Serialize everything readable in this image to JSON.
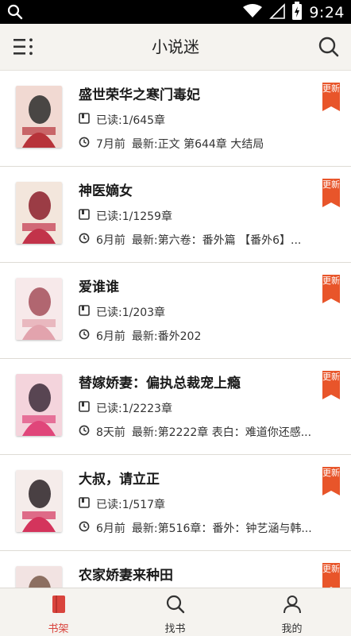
{
  "status_bar": {
    "time": "9:24"
  },
  "app_bar": {
    "title": "小说迷"
  },
  "books": [
    {
      "title": "盛世荣华之寒门毒妃",
      "read": "已读:1/645章",
      "ago": "7月前",
      "latest": "最新:正文 第644章 大结局",
      "badge": "更新",
      "cover_colors": [
        "#f1d9d2",
        "#b7333a",
        "#2b2b2b"
      ]
    },
    {
      "title": "神医嫡女",
      "read": "已读:1/1259章",
      "ago": "6月前",
      "latest": "最新:第六卷：番外篇 【番外6】...",
      "badge": "更新",
      "cover_colors": [
        "#f3e6dc",
        "#c2334a",
        "#8b1d2a"
      ]
    },
    {
      "title": "爱谁谁",
      "read": "已读:1/203章",
      "ago": "6月前",
      "latest": "最新:番外202",
      "badge": "更新",
      "cover_colors": [
        "#f7e9ea",
        "#e2a3ad",
        "#a54f5a"
      ]
    },
    {
      "title": "替嫁娇妻：偏执总裁宠上瘾",
      "read": "已读:1/2223章",
      "ago": "8天前",
      "latest": "最新:第2222章 表白：难道你还感...",
      "badge": "更新",
      "cover_colors": [
        "#f4d4dc",
        "#e0467a",
        "#3c2b3a"
      ]
    },
    {
      "title": "大叔，请立正",
      "read": "已读:1/517章",
      "ago": "6月前",
      "latest": "最新:第516章：番外：钟艺涵与韩...",
      "badge": "更新",
      "cover_colors": [
        "#f5ecea",
        "#d4345c",
        "#2a2226"
      ]
    },
    {
      "title": "农家娇妻来种田",
      "read": "",
      "ago": "",
      "latest": "",
      "badge": "更新",
      "cover_colors": [
        "#f2e3e2",
        "#c43a3f",
        "#7a5a4a"
      ]
    }
  ],
  "tabs": [
    {
      "label": "书架",
      "icon": "bookshelf-icon",
      "active": true
    },
    {
      "label": "找书",
      "icon": "search-icon",
      "active": false
    },
    {
      "label": "我的",
      "icon": "person-icon",
      "active": false
    }
  ],
  "colors": {
    "accent": "#d9443d",
    "badge": "#e8552a",
    "bar_bg": "#f5f3ef"
  }
}
